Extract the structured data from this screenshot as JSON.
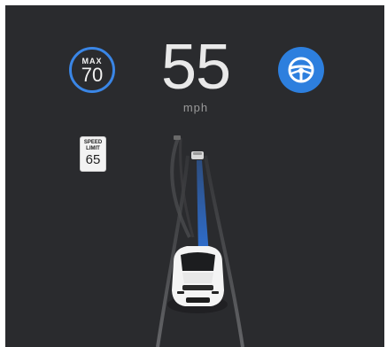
{
  "cruise": {
    "max_label": "MAX",
    "max_value": "70"
  },
  "speedometer": {
    "speed": "55",
    "unit": "mph"
  },
  "autosteer": {
    "icon": "steering-wheel-icon",
    "color": "#2d7fde"
  },
  "speed_limit_sign": {
    "line1": "SPEED",
    "line2": "LIMIT",
    "value": "65"
  },
  "colors": {
    "background": "#2a2b2e",
    "accent": "#3a86e6",
    "path": "#2f6fd0"
  }
}
